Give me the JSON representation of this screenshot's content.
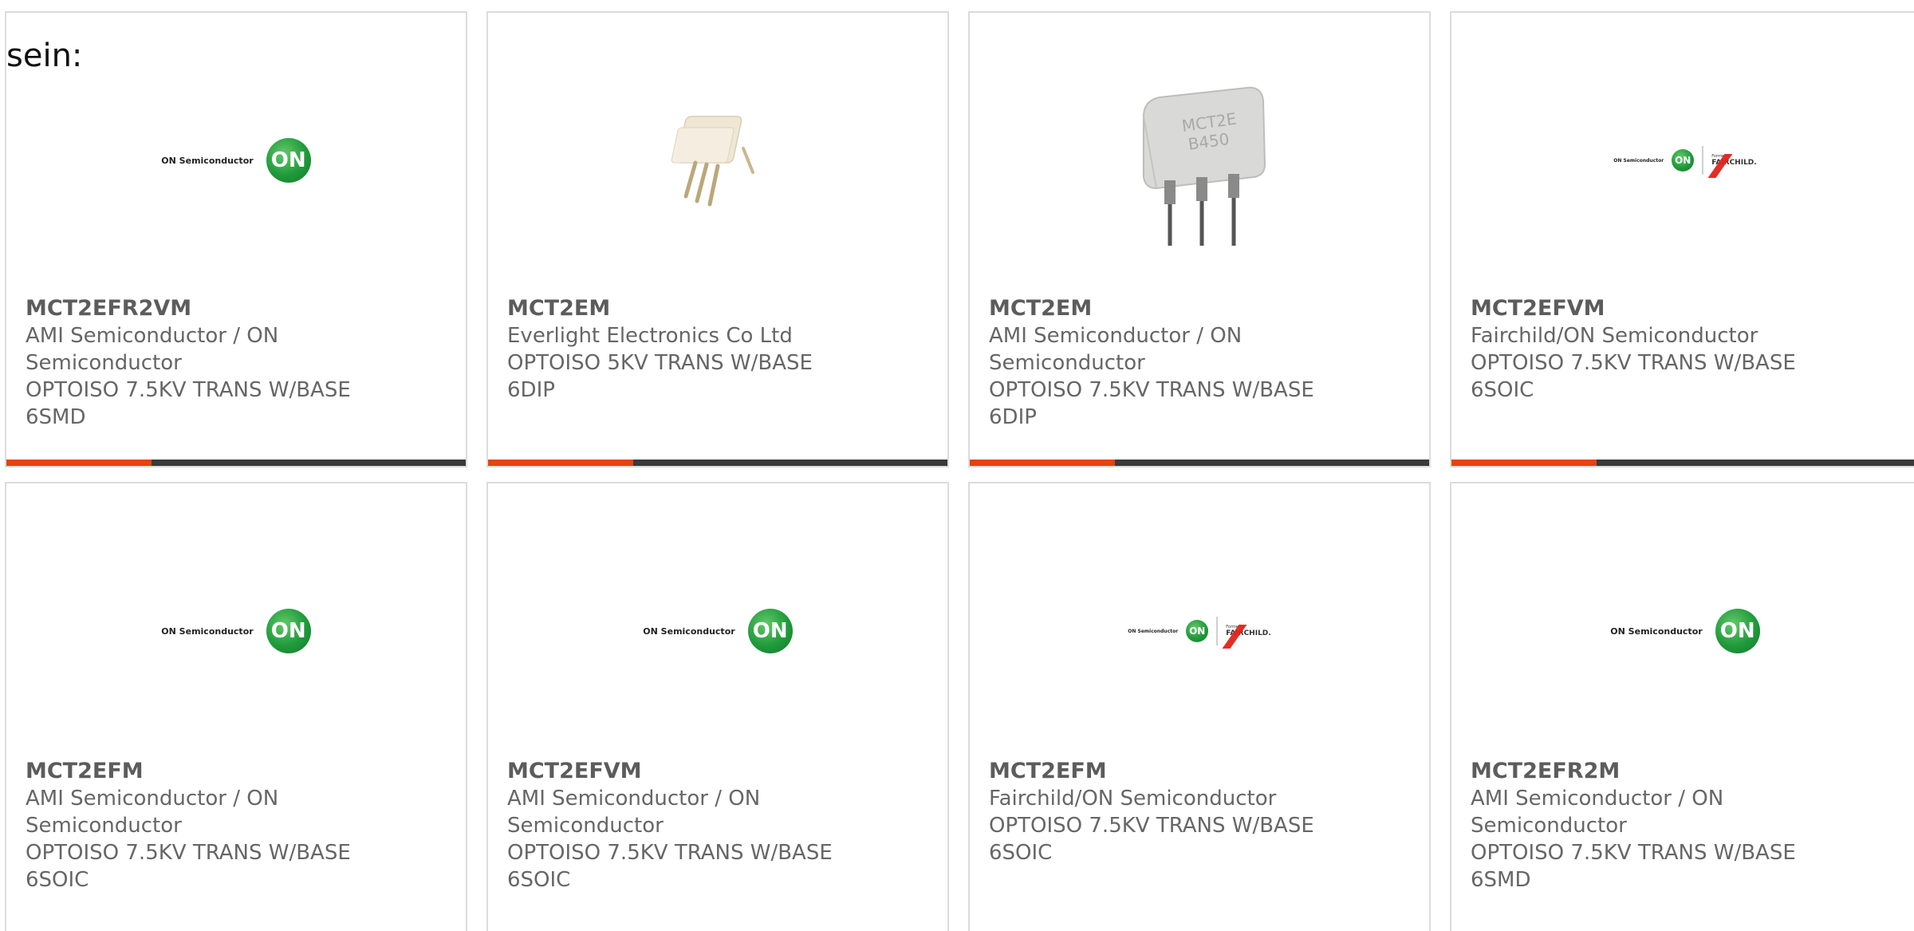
{
  "intro_text": "sein:",
  "colors": {
    "accent": "#e8410f",
    "bar": "#3a3a3a",
    "border": "#dcdcdc",
    "text": "#666666",
    "on_green": "#1f9a3b",
    "fairchild_red": "#e2231a"
  },
  "logo": {
    "on_text": "ON Semiconductor",
    "on_mark": "ON",
    "fairchild_formerly": "Formerly",
    "fairchild_name": "FAIRCHILD.",
    "chip_marking_1": "MCT2E",
    "chip_marking_2": "B450"
  },
  "products": [
    {
      "part": "MCT2EFR2VM",
      "manufacturer": "AMI Semiconductor / ON\nSemiconductor",
      "description": "OPTOISO 7.5KV TRANS W/BASE\n6SMD",
      "image": "on-semiconductor-logo"
    },
    {
      "part": "MCT2EM",
      "manufacturer": "Everlight Electronics Co Ltd",
      "description": "OPTOISO 5KV TRANS W/BASE\n6DIP",
      "image": "dip6-chip-photo-small"
    },
    {
      "part": "MCT2EM",
      "manufacturer": "AMI Semiconductor / ON\nSemiconductor",
      "description": "OPTOISO 7.5KV TRANS W/BASE\n6DIP",
      "image": "dip6-chip-photo-large"
    },
    {
      "part": "MCT2EFVM",
      "manufacturer": "Fairchild/ON Semiconductor",
      "description": "OPTOISO 7.5KV TRANS W/BASE\n6SOIC",
      "image": "on-fairchild-logo"
    },
    {
      "part": "MCT2EFM",
      "manufacturer": "AMI Semiconductor / ON\nSemiconductor",
      "description": "OPTOISO 7.5KV TRANS W/BASE\n6SOIC",
      "image": "on-semiconductor-logo"
    },
    {
      "part": "MCT2EFVM",
      "manufacturer": "AMI Semiconductor / ON\nSemiconductor",
      "description": "OPTOISO 7.5KV TRANS W/BASE\n6SOIC",
      "image": "on-semiconductor-logo"
    },
    {
      "part": "MCT2EFM",
      "manufacturer": "Fairchild/ON Semiconductor",
      "description": "OPTOISO 7.5KV TRANS W/BASE\n6SOIC",
      "image": "on-fairchild-logo"
    },
    {
      "part": "MCT2EFR2M",
      "manufacturer": "AMI Semiconductor / ON\nSemiconductor",
      "description": "OPTOISO 7.5KV TRANS W/BASE\n6SMD",
      "image": "on-semiconductor-logo"
    }
  ]
}
